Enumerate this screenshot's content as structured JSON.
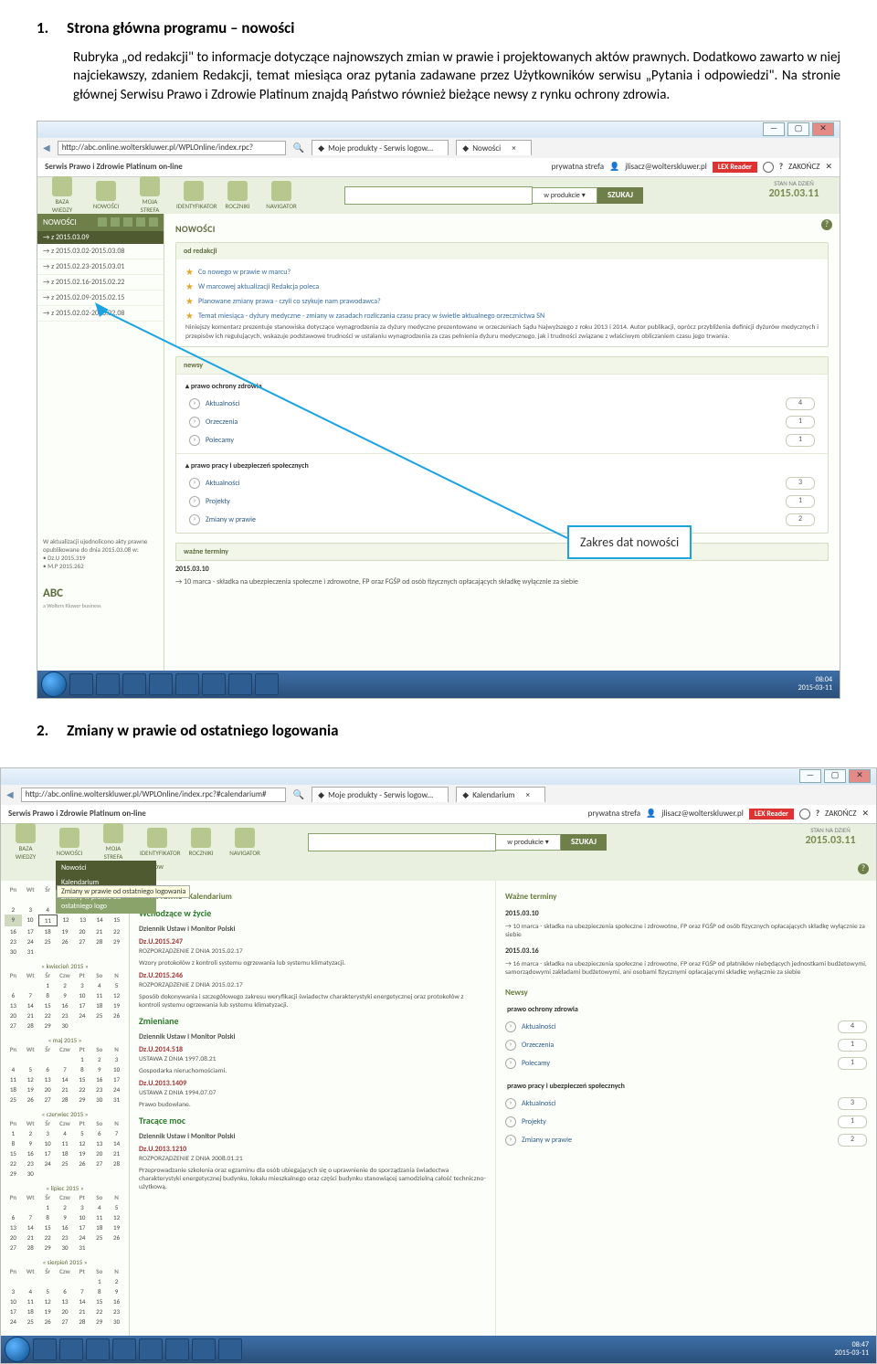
{
  "doc": {
    "s1_num": "1.",
    "s1_title": "Strona główna programu – nowości",
    "para1": "Rubryka „od redakcji\" to informacje dotyczące najnowszych zmian w prawie i projektowanych aktów prawnych. Dodatkowo zawarto w niej najciekawszy, zdaniem Redakcji, temat miesiąca oraz pytania zadawane przez Użytkowników serwisu „Pytania i odpowiedzi\". Na stronie głównej Serwisu Prawo i Zdrowie Platinum znajdą Państwo również bieżące newsy z rynku ochrony zdrowia.",
    "s2_num": "2.",
    "s2_title": "Zmiany w prawie od ostatniego logowania",
    "callout": "Zakres dat nowości"
  },
  "win": {
    "btn_min": "—",
    "btn_max": "▢",
    "btn_close": "✕"
  },
  "shot1": {
    "url": "http://abc.online.wolterskluwer.pl/WPLOnline/index.rpc?",
    "tab1": "Moje produkty - Serwis logow...",
    "tab2": "Nowości",
    "product": "Serwis Prawo i Zdrowie Platinum on-line",
    "user_area": "prywatna strefa",
    "user": "jlisacz@wolterskluwer.pl",
    "lex": "LEX Reader",
    "zak": "ZAKOŃCZ",
    "tools": [
      "BAZA WIEDZY",
      "NOWOŚCI",
      "MOJA STREFA",
      "IDENTYFIKATOR",
      "ROCZNIKI",
      "NAVIGATOR"
    ],
    "search_filter": "w produkcie",
    "search_btn": "SZUKAJ",
    "date_lbl": "STAN NA DZIEŃ",
    "date_val": "2015.03.11",
    "side_label": "NOWOŚCI",
    "side_range": "→ z 2015.03.09",
    "side_items": [
      "→ z 2015.03.02-2015.03.08",
      "→ z 2015.02.23-2015.03.01",
      "→ z 2015.02.16-2015.02.22",
      "→ z 2015.02.09-2015.02.15",
      "→ z 2015.02.02-2015.02.08"
    ],
    "side_note": "W aktualizacji ujednolicono akty prawne opublikowane do dnia 2015.03.08 w:",
    "side_note_items": [
      "• Dz.U 2015.319",
      "• M.P 2015.262"
    ],
    "abc": "ABC",
    "abc_sub": "a Wolters Kluwer business",
    "panel_title": "NOWOŚCI",
    "box_redakcja": "od redakcji",
    "red_links": [
      "Co nowego w prawie w marcu?",
      "W marcowej aktualizacji Redakcja poleca",
      "Planowane zmiany prawa - czyli co szykuje nam prawodawca?"
    ],
    "red_theme": "Temat miesiąca - dyżury medyczne - zmiany w zasadach rozliczania czasu pracy w świetle aktualnego orzecznictwa SN",
    "red_desc": "Niniejszy komentarz prezentuje stanowiska dotyczące wynagrodzenia za dyżury medyczne prezentowane w orzeczeniach Sądu Najwyższego z roku 2013 i 2014. Autor publikacji, oprócz przybliżenia definicji dyżurów medycznych i przepisów ich regulujących, wskazuje podstawowe trudności w ustalaniu wynagrodzenia za czas pełnienia dyżuru medycznego, jak i trudności związane z właściwym obliczaniem czasu jego trwania.",
    "box_news": "newsy",
    "ns1": "prawo ochrony zdrowia",
    "ns1_rows": [
      {
        "label": "Aktualności",
        "count": "4"
      },
      {
        "label": "Orzeczenia",
        "count": "1"
      },
      {
        "label": "Polecamy",
        "count": "1"
      }
    ],
    "ns2": "prawo pracy i ubezpieczeń społecznych",
    "ns2_rows": [
      {
        "label": "Aktualności",
        "count": "3"
      },
      {
        "label": "Projekty",
        "count": "1"
      },
      {
        "label": "Zmiany w prawie",
        "count": "2"
      }
    ],
    "box_wazne": "ważne terminy",
    "waz_date": "2015.03.10",
    "waz_item": "→ 10 marca - składka na ubezpieczenia społeczne i zdrowotne, FP oraz FGŚP od osób fizycznych opłacających składkę wyłącznie za siebie",
    "tb_time": "08:04",
    "tb_date": "2015-03-11"
  },
  "shot2": {
    "url": "http://abc.online.wolterskluwer.pl/WPLOnline/index.rpc?#calendarium#",
    "tab1": "Moje produkty - Serwis logow...",
    "tab2": "Kalendarium",
    "dd": [
      "Nowości",
      "Kalendarium",
      "Zmiany w prawie od ostatniego logo"
    ],
    "tip": "Zmiany w prawie od ostatniego logowania",
    "tabs_small": "aktów",
    "months": [
      "kwiecień 2015",
      "maj 2015",
      "czerwiec 2015",
      "lipiec 2015",
      "sierpień 2015"
    ],
    "days": [
      "Pn",
      "Wt",
      "Śr",
      "Czw",
      "Pt",
      "So",
      "N"
    ],
    "left_title": "Akty Prawne - Kalendarium",
    "g1": "Wchodzące w życie",
    "sub1": "Dziennik Ustaw i Monitor Polski",
    "e1_id": "Dz.U.2015.247",
    "e1_t": "ROZPORZĄDZENIE Z DNIA 2015.02.17",
    "e1_d": "Wzory protokołów z kontroli systemu ogrzewania lub systemu klimatyzacji.",
    "e2_id": "Dz.U.2015.246",
    "e2_t": "ROZPORZĄDZENIE Z DNIA 2015.02.17",
    "e2_d": "Sposób dokonywania i szczegółowego zakresu weryfikacji świadectw charakterystyki energetycznej oraz protokołów z kontroli systemu ogrzewania lub systemu klimatyzacji.",
    "g2": "Zmieniane",
    "e3_id": "Dz.U.2014.518",
    "e3_t": "USTAWA Z DNIA 1997.08.21",
    "e3_d": "Gospodarka nieruchomościami.",
    "e4_id": "Dz.U.2013.1409",
    "e4_t": "USTAWA Z DNIA 1994.07.07",
    "e4_d": "Prawo budowlane.",
    "g3": "Tracące moc",
    "e5_id": "Dz.U.2013.1210",
    "e5_t": "ROZPORZĄDZENIE Z DNIA 2008.01.21",
    "e5_d": "Przeprowadzanie szkolenia oraz egzaminu dla osób ubiegających się o uprawnienie do sporządzania świadectwa charakterystyki energetycznej budynku, lokalu mieszkalnego oraz części budynku stanowiącej samodzielną całość techniczno-użytkową.",
    "right_title": "Ważne terminy",
    "r_d1": "2015.03.10",
    "r_i1": "→ 10 marca - składka na ubezpieczenia społeczne i zdrowotne, FP oraz FGŚP od osób fizycznych opłacających składkę wyłącznie za siebie",
    "r_d2": "2015.03.16",
    "r_i2": "→ 16 marca - składka na ubezpieczenia społeczne i zdrowotne, FP oraz FGŚP od płatników niebędących jednostkami budżetowymi, samorządowymi zakładami budżetowymi, ani osobami fizycznymi opłacającymi składkę wyłącznie za siebie",
    "r_news": "Newsy",
    "r_ns1": "prawo ochrony zdrowia",
    "r_ns1_rows": [
      {
        "label": "Aktualności",
        "count": "4"
      },
      {
        "label": "Orzeczenia",
        "count": "1"
      },
      {
        "label": "Polecamy",
        "count": "1"
      }
    ],
    "r_ns2": "prawo pracy i ubezpieczeń społecznych",
    "r_ns2_rows": [
      {
        "label": "Aktualności",
        "count": "3"
      },
      {
        "label": "Projekty",
        "count": "1"
      },
      {
        "label": "Zmiany w prawie",
        "count": "2"
      }
    ],
    "tb_time": "08:47",
    "tb_date": "2015-03-11"
  }
}
